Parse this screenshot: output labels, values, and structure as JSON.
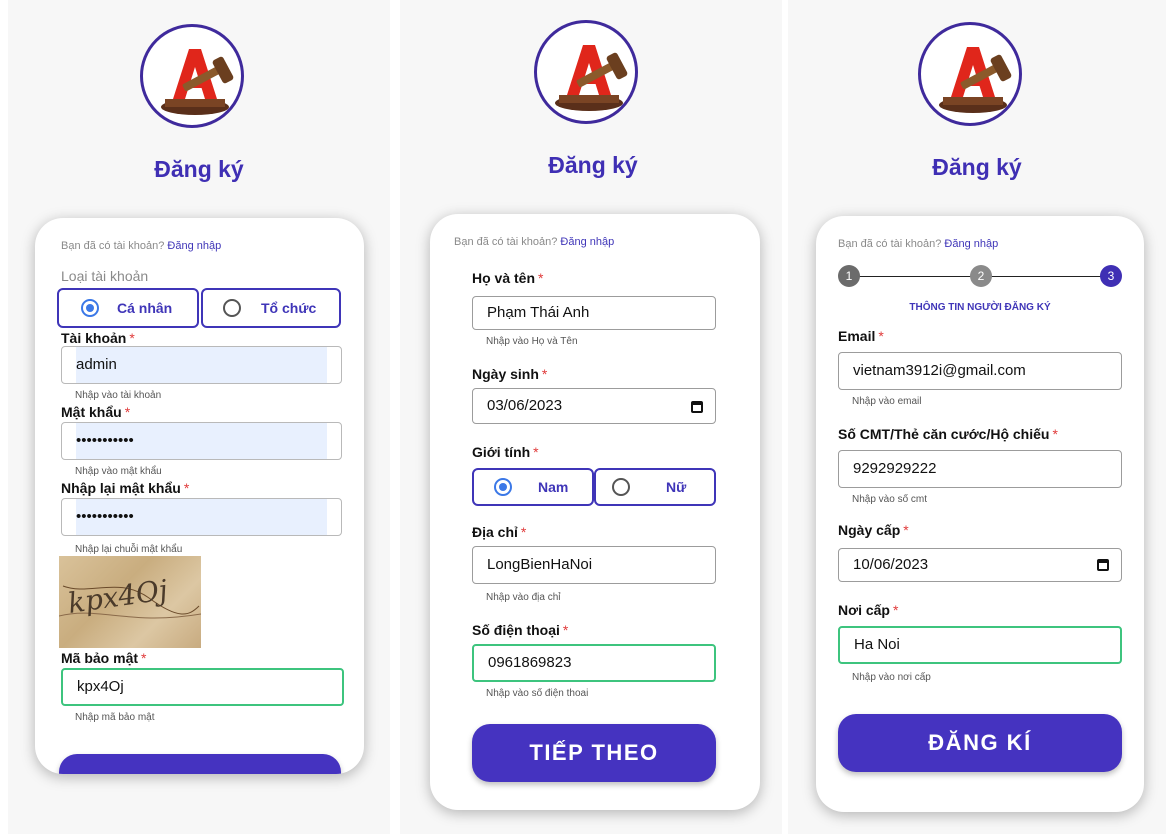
{
  "common": {
    "title": "Đăng ký",
    "have_account": "Bạn đã có tài khoản?",
    "login_link": "Đăng nhập",
    "required_mark": "*"
  },
  "step1": {
    "account_type_label": "Loại tài khoản",
    "account_types": [
      {
        "label": "Cá nhân",
        "selected": true
      },
      {
        "label": "Tổ chức",
        "selected": false
      }
    ],
    "username": {
      "label": "Tài khoản",
      "value": "admin",
      "hint": "Nhập vào tài khoản"
    },
    "password": {
      "label": "Mật khẩu",
      "value": "•••••••••••",
      "hint": "Nhập vào mật khẩu"
    },
    "confirm_password": {
      "label": "Nhập lại mật khẩu",
      "value": "•••••••••••",
      "hint": "Nhập lại chuỗi mật khẩu"
    },
    "captcha_image_text": "kpx4Oj",
    "captcha": {
      "label": "Mã bảo mật",
      "value": "kpx4Oj",
      "hint": "Nhập mã bảo mật"
    }
  },
  "step2": {
    "fullname": {
      "label": "Họ và tên",
      "value": "Phạm Thái Anh",
      "hint": "Nhập vào Họ và Tên"
    },
    "dob": {
      "label": "Ngày sinh",
      "value": "03/06/2023"
    },
    "gender_label": "Giới tính",
    "genders": [
      {
        "label": "Nam",
        "selected": true
      },
      {
        "label": "Nữ",
        "selected": false
      }
    ],
    "address": {
      "label": "Địa chỉ",
      "value": "LongBienHaNoi",
      "hint": "Nhập vào địa chỉ"
    },
    "phone": {
      "label": "Số điện thoại",
      "value": "0961869823",
      "hint": "Nhập vào số điện thoai"
    },
    "next_button": "TIẾP THEO"
  },
  "step3": {
    "steps": [
      "1",
      "2",
      "3"
    ],
    "step_title": "THÔNG TIN NGƯỜI ĐĂNG KÝ",
    "email": {
      "label": "Email",
      "value": "vietnam3912i@gmail.com",
      "hint": "Nhập vào email"
    },
    "id_number": {
      "label": "Số CMT/Thẻ căn cước/Hộ chiếu",
      "value": "9292929222",
      "hint": "Nhập vào số cmt"
    },
    "issue_date": {
      "label": "Ngày cấp",
      "value": "10/06/2023"
    },
    "issue_place": {
      "label": "Nơi cấp",
      "value": "Ha Noi",
      "hint": "Nhập vào nơi cấp"
    },
    "submit_button": "ĐĂNG KÍ"
  },
  "colors": {
    "brand": "#4533c0",
    "link": "#3f35b8",
    "required": "#e03a3a",
    "focus": "#3dc47e",
    "radio": "#3b78e7"
  }
}
